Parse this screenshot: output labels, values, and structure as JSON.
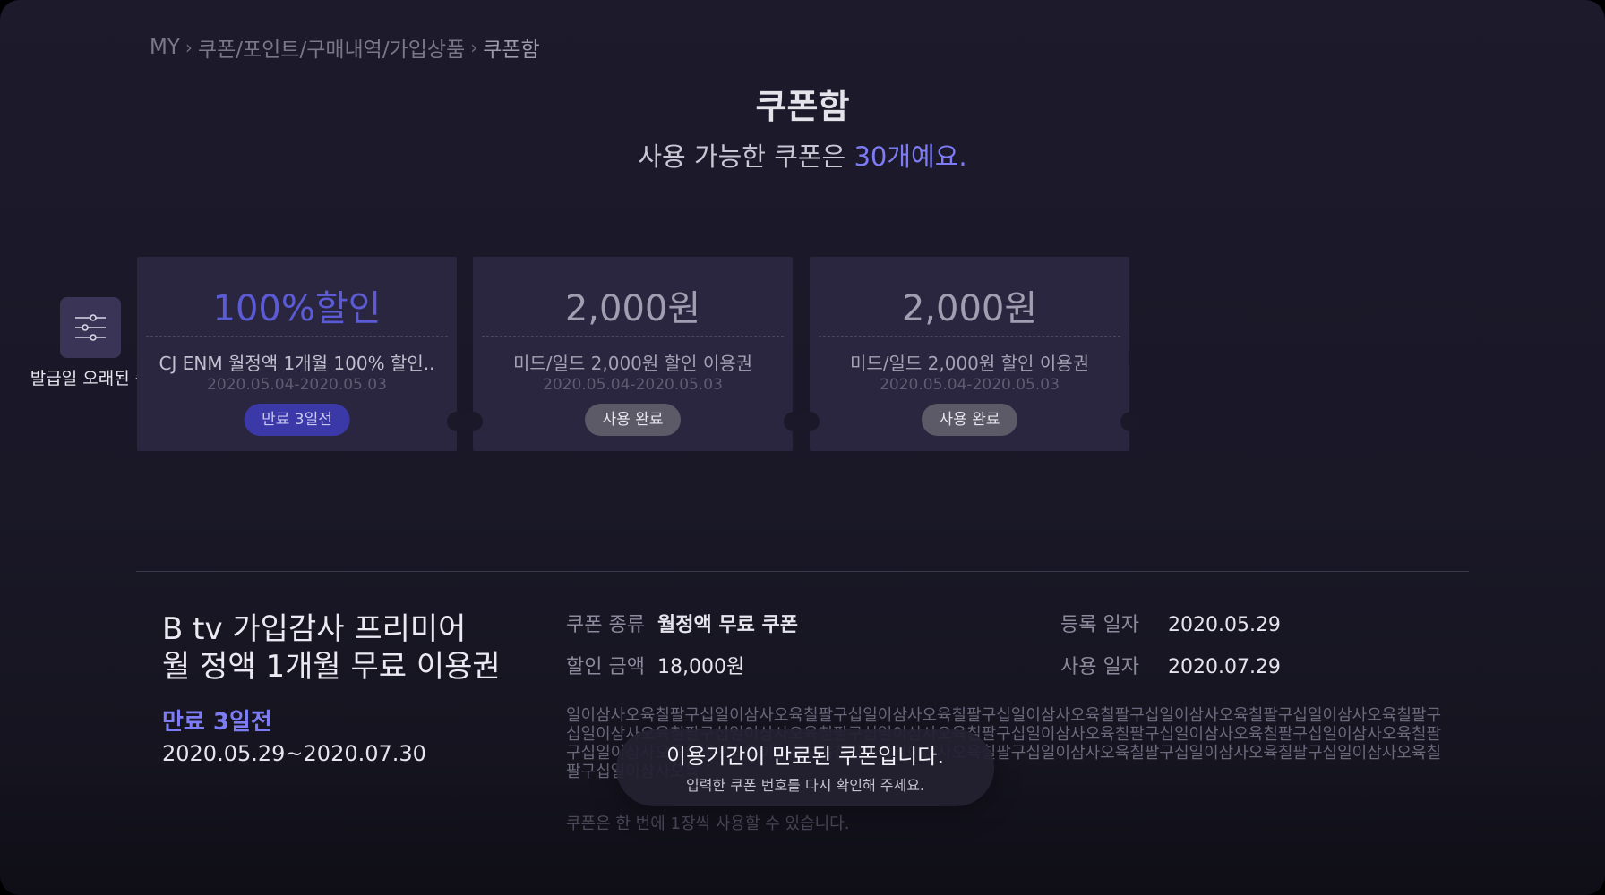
{
  "breadcrumb": {
    "items": [
      "MY",
      "쿠폰/포인트/구매내역/가입상품"
    ],
    "current": "쿠폰함"
  },
  "page": {
    "title": "쿠폰함",
    "subtitle_prefix": "사용 가능한 쿠폰은 ",
    "subtitle_highlight": "30개예요.",
    "accent_color": "#7d7cf4"
  },
  "filter": {
    "icon": "sliders-icon",
    "label": "발급일 오래된 순"
  },
  "coupons": [
    {
      "amount": "100%할인",
      "name": "CJ ENM 월정액 1개월 100% 할인..",
      "period": "2020.05.04-2020.05.03",
      "badge": "만료 3일전",
      "state": "active"
    },
    {
      "amount": "2,000원",
      "name": "미드/일드 2,000원 할인 이용권",
      "period": "2020.05.04-2020.05.03",
      "badge": "사용 완료",
      "state": "used"
    },
    {
      "amount": "2,000원",
      "name": "미드/일드 2,000원 할인 이용권",
      "period": "2020.05.04-2020.05.03",
      "badge": "사용 완료",
      "state": "used"
    }
  ],
  "detail": {
    "title_line1": "B tv 가입감사 프리미어",
    "title_line2": "월 정액 1개월 무료 이용권",
    "expiry": "만료 3일전",
    "range": "2020.05.29~2020.07.30",
    "type_label": "쿠폰 종류",
    "type_value": "월정액 무료 쿠폰",
    "discount_label": "할인 금액",
    "discount_value": "18,000원",
    "reg_label": "등록 일자",
    "reg_value": "2020.05.29",
    "use_label": "사용 일자",
    "use_value": "2020.07.29",
    "description": "일이삼사오육칠팔구십일이삼사오육칠팔구십일이삼사오육칠팔구십일이삼사오육칠팔구십일이삼사오육칠팔구십일이삼사오육칠팔구십일이삼사오육칠팔구십일이삼사오육칠팔구십일이삼사오육칠팔구십일이삼사오육칠팔구십일이삼사오육칠팔구십일이삼사오육칠팔구십일이삼사오육칠팔구십일이삼사오육칠팔구십일이삼사오육칠팔구십일이삼사오육칠팔구십일이삼사오육칠팔구십일이삼사오육칠팔구십일이삼사오육",
    "note": "쿠폰은 한 번에 1장씩 사용할 수 있습니다."
  },
  "toast": {
    "title": "이용기간이 만료된 쿠폰입니다.",
    "message": "입력한 쿠폰 번호를 다시 확인해 주세요."
  }
}
